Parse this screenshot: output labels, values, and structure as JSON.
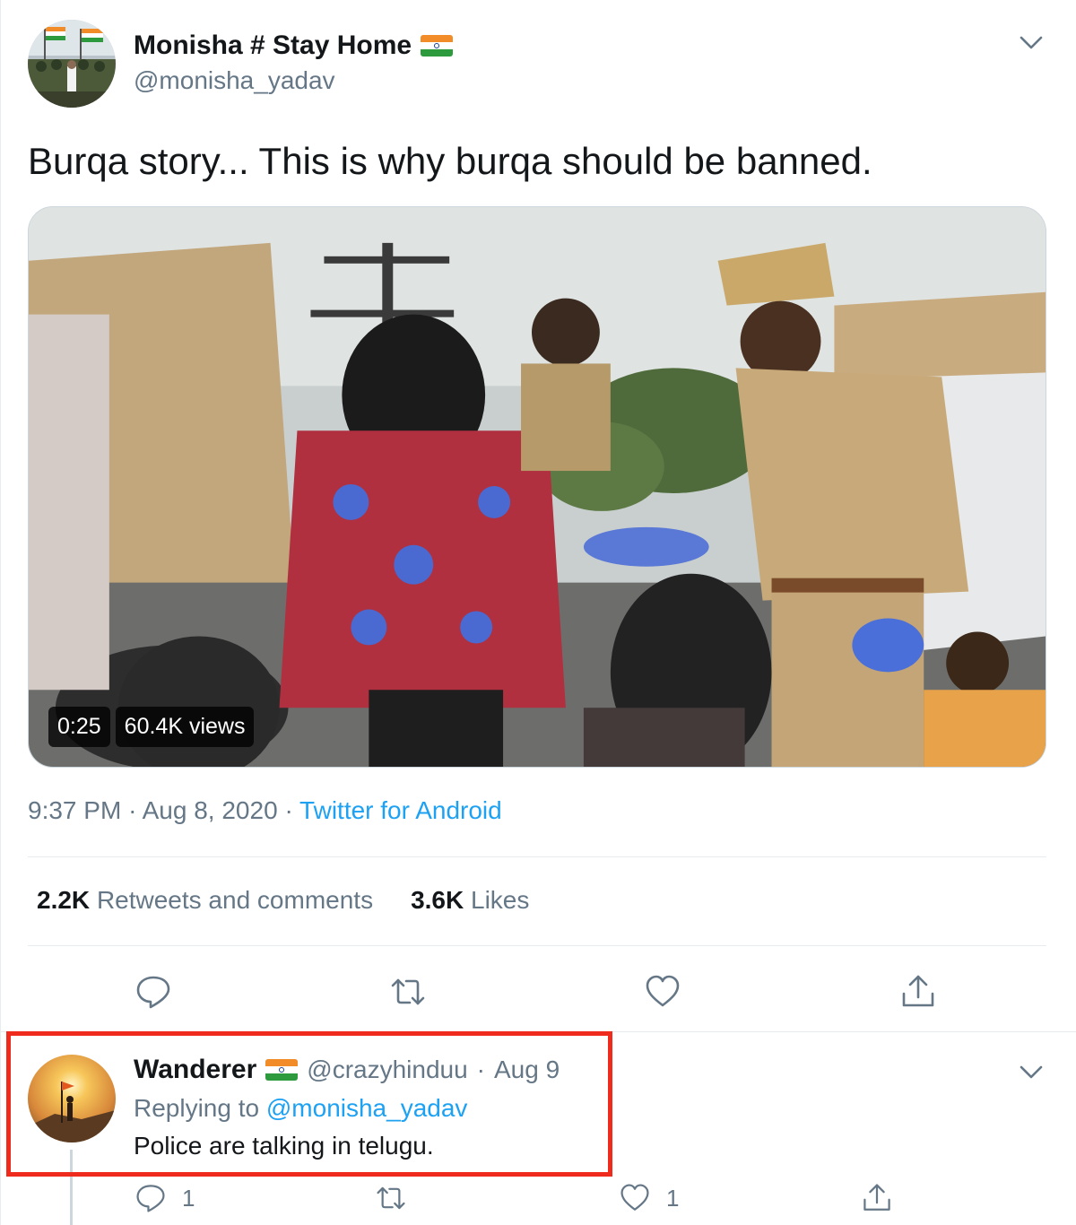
{
  "tweet": {
    "author": {
      "name": "Monisha # Stay Home",
      "handle": "@monisha_yadav",
      "flag": "india-flag-icon"
    },
    "text": "Burqa story... This is why burqa should be banned.",
    "video": {
      "duration": "0:25",
      "views": "60.4K views"
    },
    "time": "9:37 PM",
    "date": "Aug 8, 2020",
    "separator": "·",
    "source": "Twitter for Android",
    "stats": {
      "retweets_count": "2.2K",
      "retweets_label": "Retweets and comments",
      "likes_count": "3.6K",
      "likes_label": "Likes"
    },
    "actions": [
      "reply-icon",
      "retweet-icon",
      "like-icon",
      "share-icon"
    ]
  },
  "reply": {
    "name": "Wanderer",
    "flag": "india-flag-icon",
    "handle": "@crazyhinduu",
    "dot": "·",
    "date": "Aug 9",
    "replying_prefix": "Replying to",
    "replying_to": "@monisha_yadav",
    "text": "Police are talking in telugu.",
    "reply_count": "1",
    "like_count": "1"
  },
  "colors": {
    "link": "#1da1f2",
    "secondary_text": "#657786",
    "primary_text": "#14171a",
    "highlight_box": "#ee2b1c"
  }
}
